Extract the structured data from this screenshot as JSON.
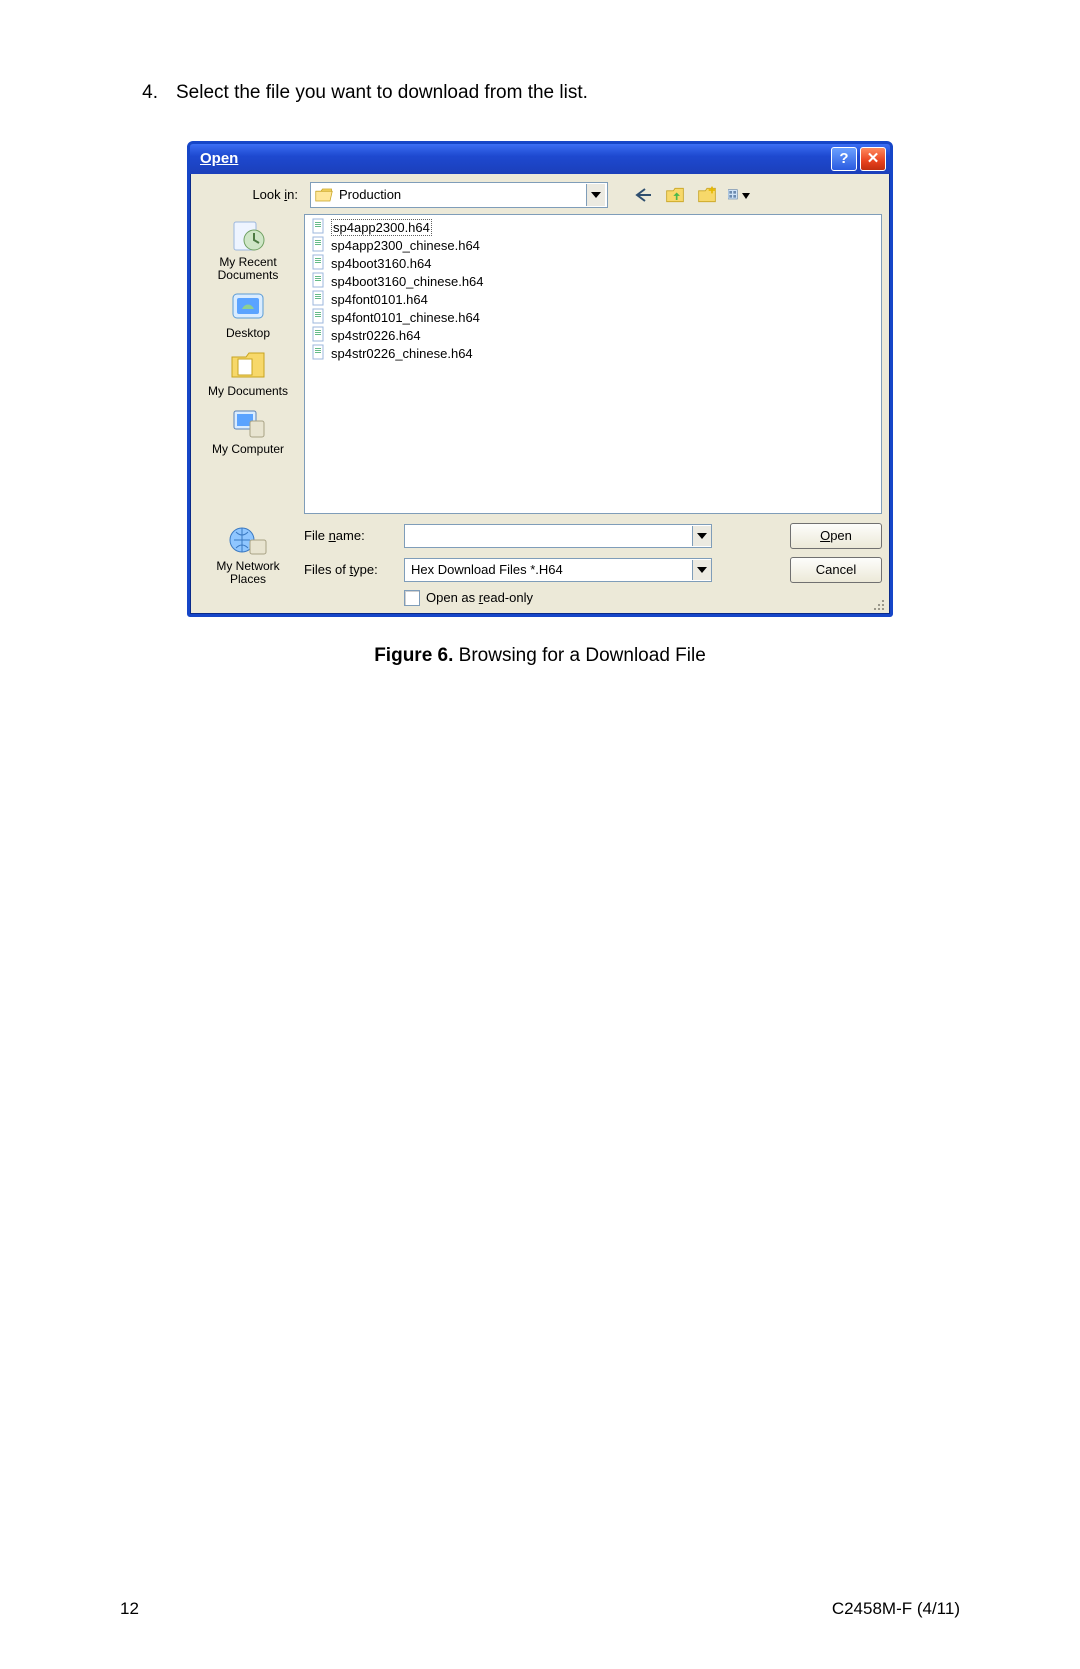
{
  "step": {
    "number": "4.",
    "text": "Select the file you want to download from the list."
  },
  "dialog": {
    "title": "Open",
    "lookin_label": "Look in:",
    "lookin_value": "Production",
    "places": [
      {
        "id": "recent",
        "label": "My Recent Documents"
      },
      {
        "id": "desktop",
        "label": "Desktop"
      },
      {
        "id": "mydocs",
        "label": "My Documents"
      },
      {
        "id": "mycomp",
        "label": "My Computer"
      },
      {
        "id": "network",
        "label": "My Network Places"
      }
    ],
    "files": [
      "sp4app2300.h64",
      "sp4app2300_chinese.h64",
      "sp4boot3160.h64",
      "sp4boot3160_chinese.h64",
      "sp4font0101.h64",
      "sp4font0101_chinese.h64",
      "sp4str0226.h64",
      "sp4str0226_chinese.h64"
    ],
    "selected_index": 0,
    "filename_label": "File name:",
    "filename_value": "",
    "filetype_label": "Files of type:",
    "filetype_value": "Hex Download Files *.H64",
    "readonly_label": "Open as read-only",
    "open_btn": "Open",
    "cancel_btn": "Cancel"
  },
  "caption": {
    "prefix": "Figure 6.",
    "text": "  Browsing for a Download File"
  },
  "footer": {
    "page": "12",
    "doc": "C2458M-F  (4/11)"
  }
}
